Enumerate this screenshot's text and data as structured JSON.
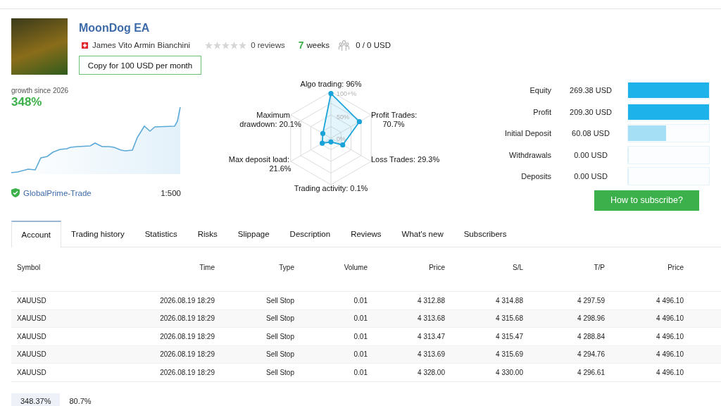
{
  "header": {
    "title": "MoonDog EA",
    "author": "James Vito Armin Bianchini",
    "stars": 0,
    "reviews": "0 reviews",
    "weeks_number": "7",
    "weeks_label": "weeks",
    "subscribers": "0 / 0 USD",
    "copy_button": "Copy for 100 USD per month"
  },
  "growth": {
    "label": "growth since 2026",
    "value": "348%",
    "broker": "GlobalPrime-Trade",
    "leverage": "1:500"
  },
  "radar": {
    "ticks": [
      "100+%",
      "50%",
      "0%"
    ],
    "axes": [
      {
        "lines": [
          "Algo trading: 96%"
        ],
        "level": 0.96
      },
      {
        "lines": [
          "Maximum",
          "drawdown: 20.1%"
        ],
        "level": 0.201
      },
      {
        "lines": [
          "Profit Trades:",
          "70.7%"
        ],
        "level": 0.707
      },
      {
        "lines": [
          "Max deposit load:",
          "21.6%"
        ],
        "level": 0.216
      },
      {
        "lines": [
          "Loss Trades: 29.3%"
        ],
        "level": 0.293
      },
      {
        "lines": [
          "Trading activity: 0.1%"
        ],
        "level": 0.001
      }
    ]
  },
  "balance": [
    {
      "label": "Equity",
      "value": "269.38 USD",
      "level": 1,
      "color": "#1db3ea"
    },
    {
      "label": "Profit",
      "value": "209.30 USD",
      "level": 1,
      "color": "#1db3ea"
    },
    {
      "label": "Initial Deposit",
      "value": "60.08 USD",
      "level": 0.47,
      "color": "#a5dff5"
    },
    {
      "label": "Withdrawals",
      "value": "0.00 USD",
      "level": 0,
      "color": "#d5eef9"
    },
    {
      "label": "Deposits",
      "value": "0.00 USD",
      "level": 0,
      "color": "#d5eef9"
    }
  ],
  "subscribe_button": "How to subscribe?",
  "tabs": [
    {
      "label": "Account",
      "selected": true
    },
    {
      "label": "Trading history",
      "selected": false
    },
    {
      "label": "Statistics",
      "selected": false
    },
    {
      "label": "Risks",
      "selected": false
    },
    {
      "label": "Slippage",
      "selected": false
    },
    {
      "label": "Description",
      "selected": false
    },
    {
      "label": "Reviews",
      "selected": false
    },
    {
      "label": "What's new",
      "selected": false
    },
    {
      "label": "Subscribers",
      "selected": false
    }
  ],
  "table": {
    "columns": [
      "Symbol",
      "Time",
      "Type",
      "Volume",
      "Price",
      "S/L",
      "T/P",
      "Price"
    ],
    "rows": [
      [
        "XAUUSD",
        "2026.08.19 18:29",
        "Sell Stop",
        "0.01",
        "4 312.88",
        "4 314.88",
        "4 297.59",
        "4 496.10"
      ],
      [
        "XAUUSD",
        "2026.08.19 18:29",
        "Sell Stop",
        "0.01",
        "4 313.68",
        "4 315.68",
        "4 298.96",
        "4 496.10"
      ],
      [
        "XAUUSD",
        "2026.08.19 18:29",
        "Sell Stop",
        "0.01",
        "4 313.47",
        "4 315.47",
        "4 288.84",
        "4 496.10"
      ],
      [
        "XAUUSD",
        "2026.08.19 18:29",
        "Sell Stop",
        "0.01",
        "4 313.69",
        "4 315.69",
        "4 294.76",
        "4 496.10"
      ],
      [
        "XAUUSD",
        "2026.08.19 18:29",
        "Sell Stop",
        "0.01",
        "4 328.00",
        "4 330.00",
        "4 296.61",
        "4 496.10"
      ]
    ]
  },
  "summary": [
    {
      "value": "348.37%",
      "selected": true
    },
    {
      "value": "80.7%",
      "selected": false
    }
  ]
}
